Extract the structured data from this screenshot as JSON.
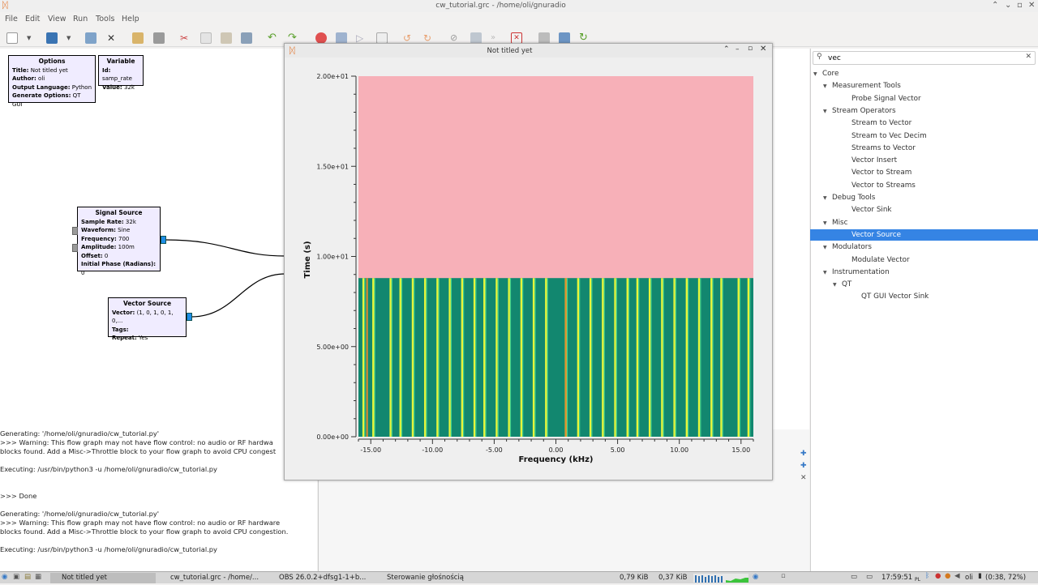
{
  "window": {
    "title": "cw_tutorial.grc - /home/oli/gnuradio"
  },
  "menu": [
    "File",
    "Edit",
    "View",
    "Run",
    "Tools",
    "Help"
  ],
  "blocks": {
    "options": {
      "title": "Options",
      "rows": [
        [
          "Title:",
          "Not titled yet"
        ],
        [
          "Author:",
          "oli"
        ],
        [
          "Output Language:",
          "Python"
        ],
        [
          "Generate Options:",
          "QT GUI"
        ]
      ]
    },
    "variable": {
      "title": "Variable",
      "rows": [
        [
          "Id:",
          "samp_rate"
        ],
        [
          "Value:",
          "32k"
        ]
      ]
    },
    "signal_source": {
      "title": "Signal Source",
      "rows": [
        [
          "Sample Rate:",
          "32k"
        ],
        [
          "Waveform:",
          "Sine"
        ],
        [
          "Frequency:",
          "700"
        ],
        [
          "Amplitude:",
          "100m"
        ],
        [
          "Offset:",
          "0"
        ],
        [
          "Initial Phase (Radians):",
          "0"
        ]
      ]
    },
    "vector_source": {
      "title": "Vector Source",
      "rows": [
        [
          "Vector:",
          "(1, 0, 1, 0, 1, 0,..."
        ],
        [
          "Tags:",
          ""
        ],
        [
          "Repeat:",
          "Yes"
        ]
      ]
    }
  },
  "console": {
    "lines": [
      "Generating: '/home/oli/gnuradio/cw_tutorial.py'",
      ">>> Warning: This flow graph may not have flow control: no audio or RF hardwa",
      "blocks found. Add a Misc->Throttle block to your flow graph to avoid CPU congest",
      "",
      "Executing: /usr/bin/python3 -u /home/oli/gnuradio/cw_tutorial.py",
      "",
      "",
      ">>> Done",
      "",
      "Generating: '/home/oli/gnuradio/cw_tutorial.py'",
      ">>> Warning: This flow graph may not have flow control: no audio or RF hardware",
      "blocks found. Add a Misc->Throttle block to your flow graph to avoid CPU congestion.",
      "",
      "Executing: /usr/bin/python3 -u /home/oli/gnuradio/cw_tutorial.py"
    ]
  },
  "library": {
    "search_value": "vec",
    "tree": [
      {
        "label": "Core",
        "level": 0,
        "expander": true
      },
      {
        "label": "Measurement Tools",
        "level": 1,
        "expander": true
      },
      {
        "label": "Probe Signal Vector",
        "level": 2,
        "expander": false
      },
      {
        "label": "Stream Operators",
        "level": 1,
        "expander": true
      },
      {
        "label": "Stream to Vector",
        "level": 2,
        "expander": false
      },
      {
        "label": "Stream to Vec Decim",
        "level": 2,
        "expander": false
      },
      {
        "label": "Streams to Vector",
        "level": 2,
        "expander": false
      },
      {
        "label": "Vector Insert",
        "level": 2,
        "expander": false
      },
      {
        "label": "Vector to Stream",
        "level": 2,
        "expander": false
      },
      {
        "label": "Vector to Streams",
        "level": 2,
        "expander": false
      },
      {
        "label": "Debug Tools",
        "level": 1,
        "expander": true
      },
      {
        "label": "Vector Sink",
        "level": 2,
        "expander": false
      },
      {
        "label": "Misc",
        "level": 1,
        "expander": true
      },
      {
        "label": "Vector Source",
        "level": 2,
        "expander": false,
        "selected": true
      },
      {
        "label": "Modulators",
        "level": 1,
        "expander": true
      },
      {
        "label": "Modulate Vector",
        "level": 2,
        "expander": false
      },
      {
        "label": "Instrumentation",
        "level": 1,
        "expander": true
      },
      {
        "label": "QT",
        "level": 2,
        "expander": true
      },
      {
        "label": "QT GUI Vector Sink",
        "level": 3,
        "expander": false
      }
    ]
  },
  "plot": {
    "window_title": "Not titled yet",
    "colors": {
      "background": "#f7b0b8",
      "base": "#12876f",
      "bright": "#e7f53a",
      "mid": "#3fd18f",
      "hot": "#e98a2c"
    }
  },
  "chart_data": {
    "type": "heatmap",
    "title": "",
    "xlabel": "Frequency (kHz)",
    "ylabel": "Time (s)",
    "xlim": [
      -16,
      16
    ],
    "ylim": [
      0,
      20
    ],
    "xticks": [
      "-15.00",
      "-10.00",
      "-5.00",
      "0.00",
      "5.00",
      "10.00",
      "15.00"
    ],
    "yticks": [
      "0.00e+00",
      "5.00e+00",
      "1.00e+01",
      "1.50e+01",
      "2.00e+01"
    ],
    "filled_time_range": [
      0,
      8.8
    ],
    "bright_line_freqs_khz": [
      -15.6,
      -14.8,
      -13.4,
      -12.6,
      -11.6,
      -10.6,
      -9.6,
      -8.6,
      -7.6,
      -6.6,
      -5.8,
      -4.8,
      -3.8,
      -2.8,
      -1.8,
      -0.8,
      0.8,
      1.8,
      2.8,
      3.8,
      4.8,
      5.8,
      6.6,
      7.6,
      8.6,
      9.6,
      10.6,
      11.6,
      12.6,
      13.4,
      14.8,
      15.6
    ],
    "hot_line_freqs_khz": [
      -15.3,
      0.8
    ]
  },
  "taskbar": {
    "tasks": [
      "Not titled yet",
      "cw_tutorial.grc - /home/...",
      "OBS 26.0.2+dfsg1-1+b...",
      "Sterowanie głośnością"
    ],
    "net_down": "0,79 KiB",
    "net_up": "0,37 KiB",
    "clock": "17:59:51",
    "lang": "PL",
    "user": "oli",
    "battery": "(0:38, 72%)"
  }
}
